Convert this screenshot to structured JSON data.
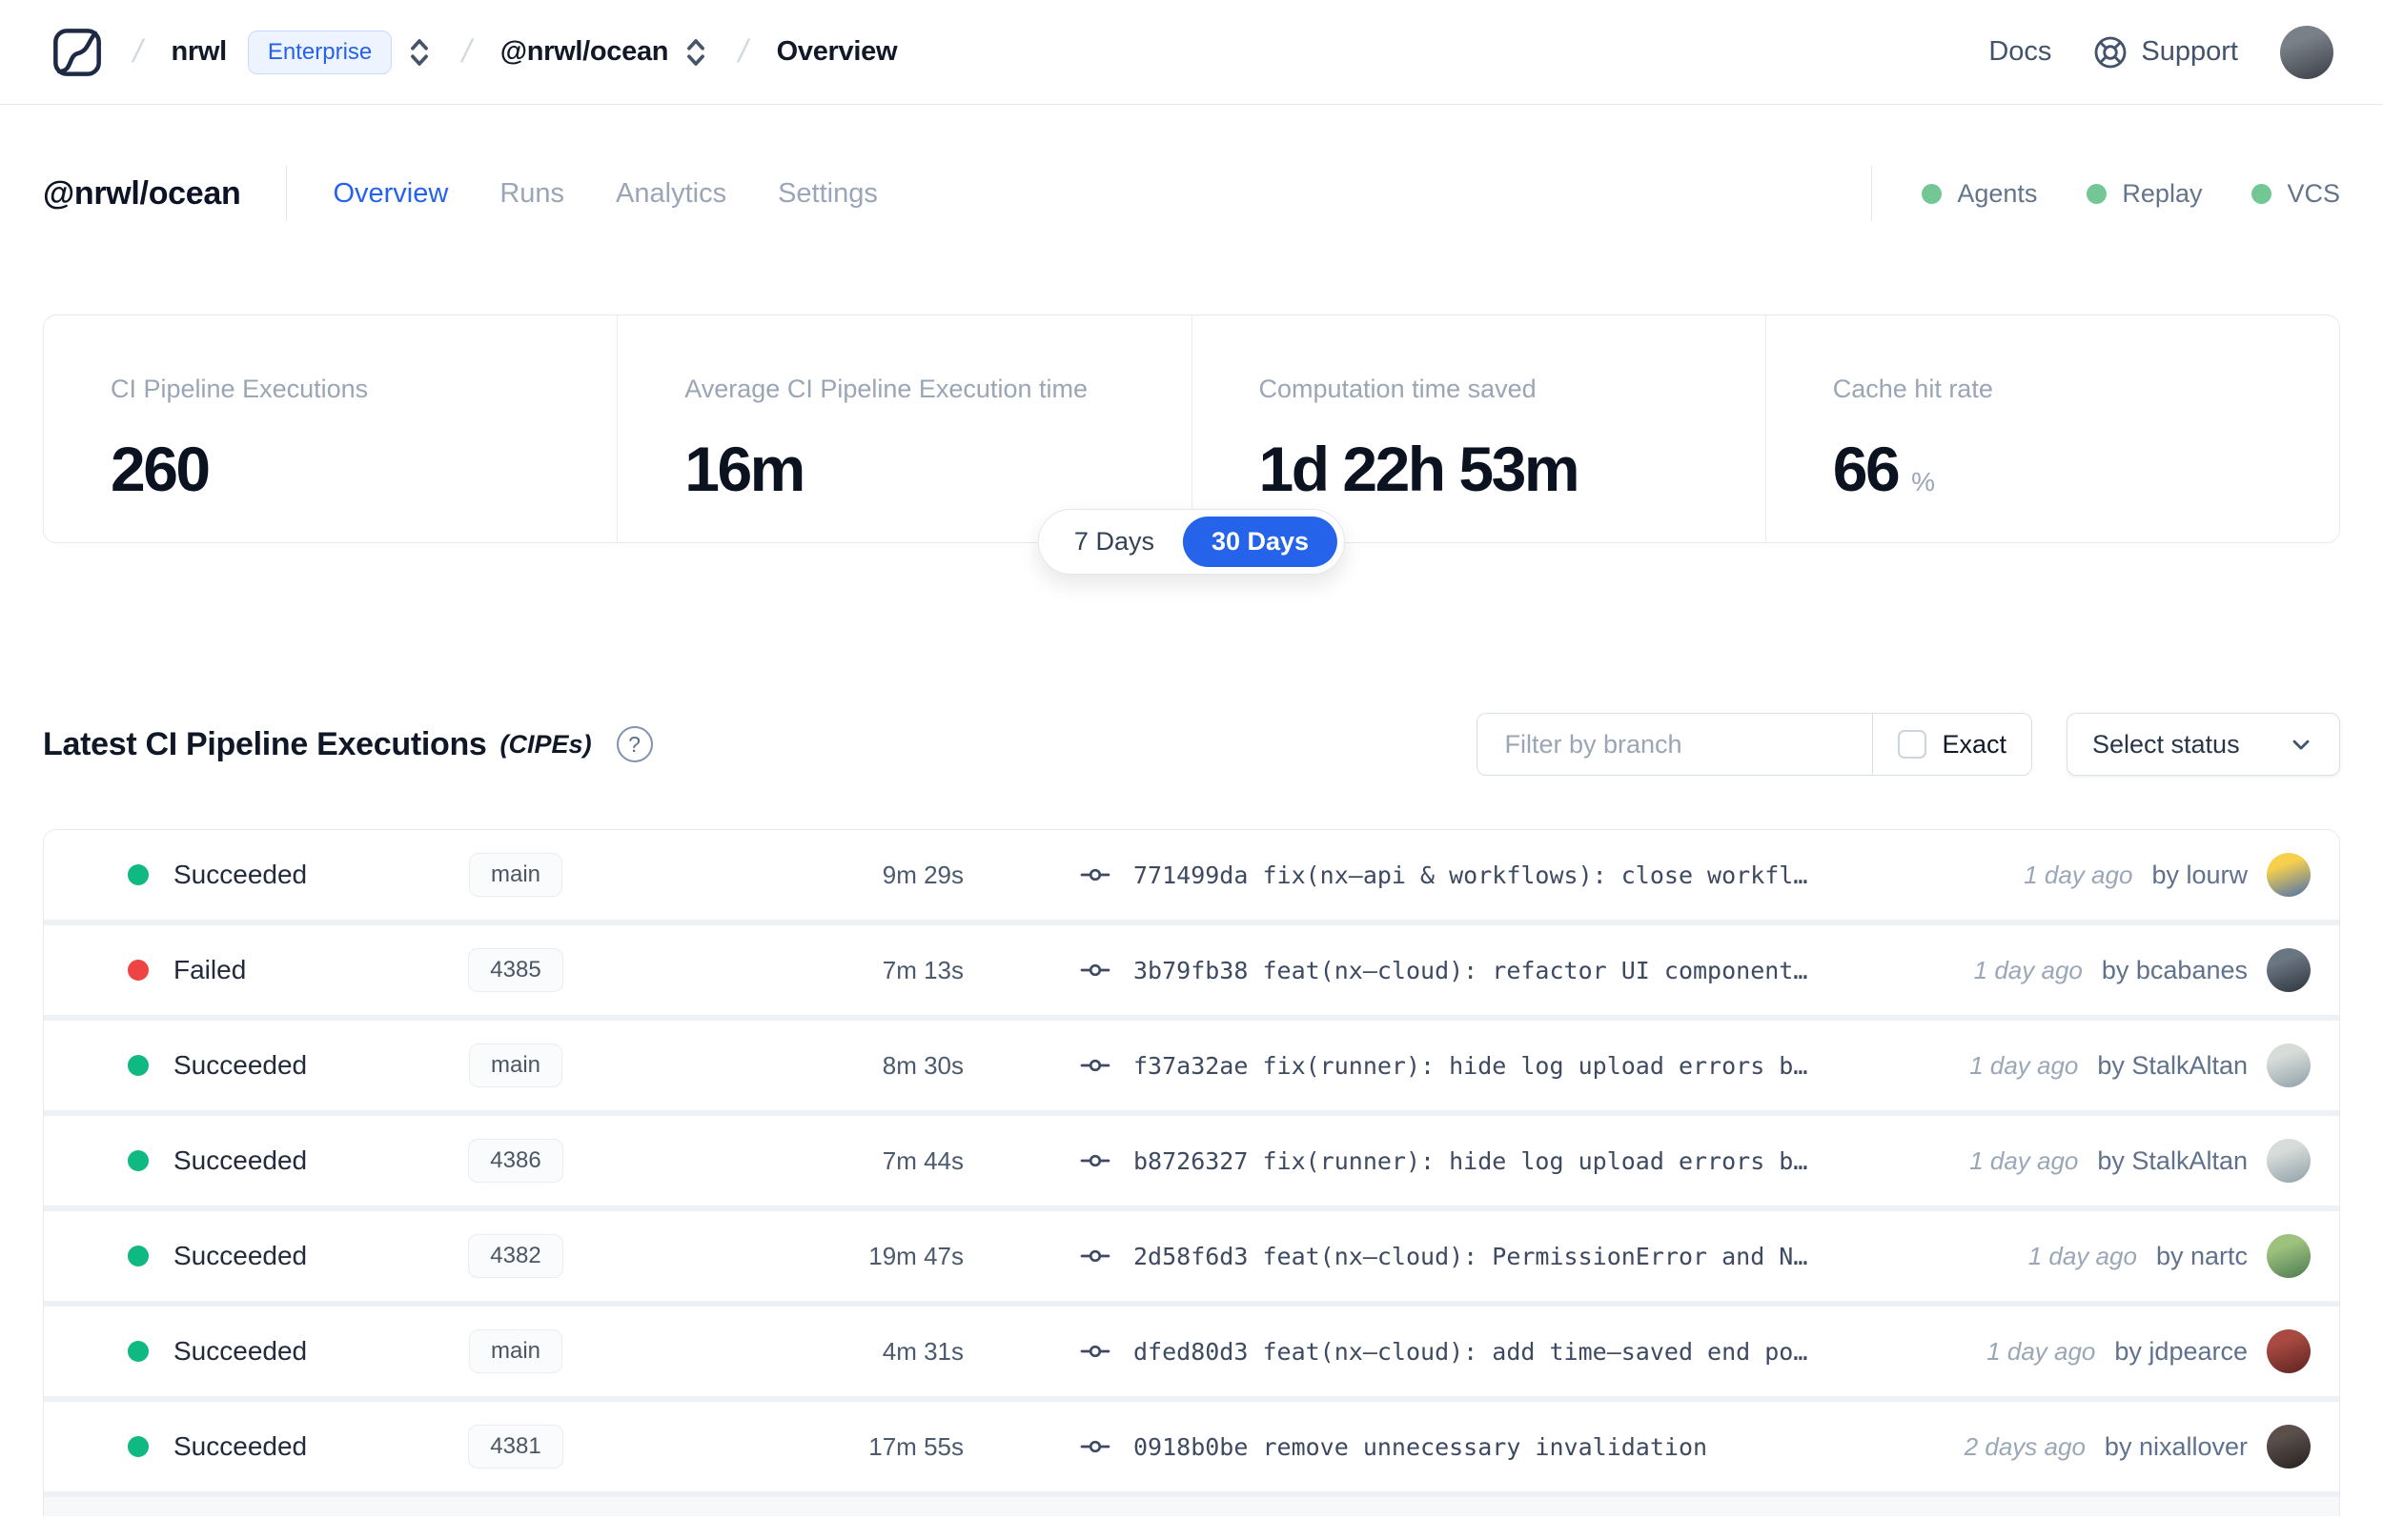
{
  "nav": {
    "breadcrumb": {
      "org": "nrwl",
      "org_badge": "Enterprise",
      "workspace": "@nrwl/ocean",
      "page": "Overview"
    },
    "docs_label": "Docs",
    "support_label": "Support"
  },
  "header": {
    "title": "@nrwl/ocean",
    "tabs": [
      {
        "label": "Overview",
        "active": true
      },
      {
        "label": "Runs",
        "active": false
      },
      {
        "label": "Analytics",
        "active": false
      },
      {
        "label": "Settings",
        "active": false
      }
    ],
    "indicators": [
      {
        "label": "Agents",
        "color": "#72c794"
      },
      {
        "label": "Replay",
        "color": "#72c794"
      },
      {
        "label": "VCS",
        "color": "#72c794"
      }
    ]
  },
  "stats": {
    "cards": [
      {
        "label": "CI Pipeline Executions",
        "value": "260",
        "suffix": ""
      },
      {
        "label": "Average CI Pipeline Execution time",
        "value": "16m",
        "suffix": ""
      },
      {
        "label": "Computation time saved",
        "value": "1d 22h 53m",
        "suffix": ""
      },
      {
        "label": "Cache hit rate",
        "value": "66",
        "suffix": "%"
      }
    ],
    "range": {
      "options": [
        "7 Days",
        "30 Days"
      ],
      "selected": "30 Days",
      "selected_color": "#2563eb"
    }
  },
  "section": {
    "title": "Latest CI Pipeline Executions",
    "subtitle": "(CIPEs)",
    "filter_placeholder": "Filter by branch",
    "exact_label": "Exact",
    "exact_checked": false,
    "status_select_label": "Select status"
  },
  "table": {
    "status_colors": {
      "Succeeded": "#10b981",
      "Failed": "#ef4444"
    },
    "rows": [
      {
        "status": "Succeeded",
        "branch": "main",
        "duration": "9m 29s",
        "commit": "771499da fix(nx–api & workflows): close workfl…",
        "time_ago": "1 day ago",
        "author": "by lourw",
        "avatar": {
          "c1": "#f6d04d",
          "c2": "#4a6fae"
        }
      },
      {
        "status": "Failed",
        "branch": "4385",
        "duration": "7m 13s",
        "commit": "3b79fb38 feat(nx–cloud): refactor UI component…",
        "time_ago": "1 day ago",
        "author": "by bcabanes",
        "avatar": {
          "c1": "#6b7683",
          "c2": "#2e343c"
        }
      },
      {
        "status": "Succeeded",
        "branch": "main",
        "duration": "8m 30s",
        "commit": "f37a32ae fix(runner): hide log upload errors b…",
        "time_ago": "1 day ago",
        "author": "by StalkAltan",
        "avatar": {
          "c1": "#d8dcd9",
          "c2": "#8fa0a8"
        }
      },
      {
        "status": "Succeeded",
        "branch": "4386",
        "duration": "7m 44s",
        "commit": "b8726327 fix(runner): hide log upload errors b…",
        "time_ago": "1 day ago",
        "author": "by StalkAltan",
        "avatar": {
          "c1": "#d8dcd9",
          "c2": "#8fa0a8"
        }
      },
      {
        "status": "Succeeded",
        "branch": "4382",
        "duration": "19m 47s",
        "commit": "2d58f6d3 feat(nx–cloud): PermissionError and N…",
        "time_ago": "1 day ago",
        "author": "by nartc",
        "avatar": {
          "c1": "#9ec27e",
          "c2": "#4c7a52"
        }
      },
      {
        "status": "Succeeded",
        "branch": "main",
        "duration": "4m 31s",
        "commit": "dfed80d3 feat(nx–cloud): add time–saved end po…",
        "time_ago": "1 day ago",
        "author": "by jdpearce",
        "avatar": {
          "c1": "#a84a42",
          "c2": "#5d2320"
        }
      },
      {
        "status": "Succeeded",
        "branch": "4381",
        "duration": "17m 55s",
        "commit": "0918b0be remove unnecessary invalidation",
        "time_ago": "2 days ago",
        "author": "by nixallover",
        "avatar": {
          "c1": "#5a4f4b",
          "c2": "#26211f"
        }
      }
    ]
  },
  "user_avatar": {
    "c1": "#7a8088",
    "c2": "#3a3f46"
  }
}
